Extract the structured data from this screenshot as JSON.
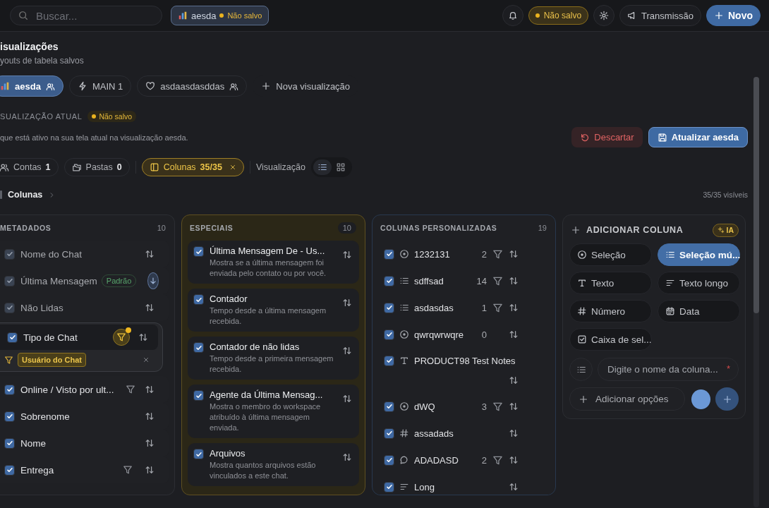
{
  "topbar": {
    "search_placeholder": "Buscar...",
    "current_view": {
      "label": "aesda",
      "status": "Não salvo"
    },
    "unsaved_badge": "Não salvo",
    "broadcast_button": "Transmissão",
    "new_button": "Novo"
  },
  "header": {
    "title": "isualizações",
    "subtitle": "youts de tabela salvos"
  },
  "views": [
    {
      "label": "aesda",
      "shared": true,
      "selected": true
    },
    {
      "label": "MAIN 1",
      "shared": false,
      "selected": false
    },
    {
      "label": "asdaasdasddas",
      "shared": true,
      "selected": false
    }
  ],
  "new_view_button": "Nova visualização",
  "current": {
    "label": "SUALIZAÇÃO ATUAL",
    "badge": "Não salvo",
    "description": "que está ativo na sua tela atual na visualização aesda.",
    "discard_button": "Descartar",
    "update_button": "Atualizar aesda"
  },
  "filters": [
    {
      "label": "Contas",
      "count": "1",
      "selected": false,
      "closable": false
    },
    {
      "label": "Pastas",
      "count": "0",
      "selected": false,
      "closable": false
    },
    {
      "label": "Colunas",
      "count": "35/35",
      "selected": true,
      "closable": true
    }
  ],
  "view_mode": {
    "label": "Visualização",
    "options": [
      {
        "selected": true
      },
      {
        "selected": false
      }
    ]
  },
  "columns_header": {
    "title": "Colunas",
    "visible": "35/35 visíveis"
  },
  "sections": [
    {
      "kind": "metadata",
      "title": "METADADOS",
      "count": "10",
      "items": [
        {
          "label": "Nome do Chat",
          "checked": true,
          "disabled": true,
          "filter": false,
          "filter_active": false,
          "sort_active": false
        },
        {
          "label": "Última Mensagem",
          "checked": true,
          "disabled": true,
          "badge": "Padrão",
          "filter": false,
          "filter_active": false,
          "sort_active": true
        },
        {
          "label": "Não Lidas",
          "checked": true,
          "disabled": true,
          "filter": false,
          "filter_active": false,
          "sort_active": false
        },
        {
          "label": "Tipo de Chat",
          "checked": true,
          "disabled": false,
          "filter": true,
          "filter_active": true,
          "sort_active": false,
          "filter_tag": "Usuário do Chat"
        },
        {
          "label": "Online / Visto por ult...",
          "checked": true,
          "disabled": false,
          "filter": true,
          "filter_active": false,
          "sort_active": false
        },
        {
          "label": "Sobrenome",
          "checked": true,
          "disabled": false,
          "filter": false,
          "filter_active": false,
          "sort_active": false
        },
        {
          "label": "Nome",
          "checked": true,
          "disabled": false,
          "filter": false,
          "filter_active": false,
          "sort_active": false
        },
        {
          "label": "Entrega",
          "checked": true,
          "disabled": false,
          "filter": true,
          "filter_active": false,
          "sort_active": false
        }
      ]
    },
    {
      "kind": "special",
      "title": "ESPECIAIS",
      "count": "10",
      "items": [
        {
          "label": "Última Mensagem De - Us...",
          "description": "Mostra se a última mensagem foi enviada pelo contato ou por você.",
          "checked": true
        },
        {
          "label": "Contador",
          "description": "Tempo desde a última mensagem recebida.",
          "checked": true
        },
        {
          "label": "Contador de não lidas",
          "description": "Tempo desde a primeira mensagem recebida.",
          "checked": true
        },
        {
          "label": "Agente da Última Mensag...",
          "description": "Mostra o membro do workspace atribuído à última mensagem enviada.",
          "checked": true
        },
        {
          "label": "Arquivos",
          "description": "Mostra quantos arquivos estão vinculados a este chat.",
          "checked": true
        }
      ]
    },
    {
      "kind": "custom",
      "title": "COLUNAS PERSONALIZADAS",
      "count": "19",
      "items": [
        {
          "label": "1232131",
          "kind": "select",
          "count": "2",
          "filter": true,
          "checked": true
        },
        {
          "label": "sdffsad",
          "kind": "multiselect",
          "count": "14",
          "filter": true,
          "checked": true
        },
        {
          "label": "asdasdas",
          "kind": "multiselect",
          "count": "1",
          "filter": true,
          "checked": true
        },
        {
          "label": "qwrqwrwqre",
          "kind": "select",
          "count": "0",
          "filter": false,
          "checked": true
        },
        {
          "label": "PRODUCT98 Test Notes",
          "kind": "text",
          "filter": false,
          "checked": true
        },
        {
          "label": "dWQ",
          "kind": "select",
          "count": "3",
          "filter": true,
          "checked": true
        },
        {
          "label": "assadads",
          "kind": "number",
          "filter": false,
          "checked": true
        },
        {
          "label": "ADADASD",
          "kind": "chat",
          "count": "2",
          "filter": true,
          "checked": true
        },
        {
          "label": "Long",
          "kind": "longtext",
          "filter": false,
          "checked": true
        }
      ]
    }
  ],
  "add_column": {
    "title": "ADICIONAR COLUNA",
    "ai_badge": "IA",
    "types": [
      {
        "label": "Seleção",
        "selected": false
      },
      {
        "label": "Seleção mú...",
        "selected": true
      },
      {
        "label": "Texto",
        "selected": false
      },
      {
        "label": "Texto longo",
        "selected": false
      },
      {
        "label": "Número",
        "selected": false
      },
      {
        "label": "Data",
        "selected": false
      },
      {
        "label": "Caixa de sel...",
        "selected": false
      }
    ],
    "name_placeholder": "Digite o nome da coluna...",
    "required_mark": "*",
    "add_options_button": "Adicionar opções"
  }
}
